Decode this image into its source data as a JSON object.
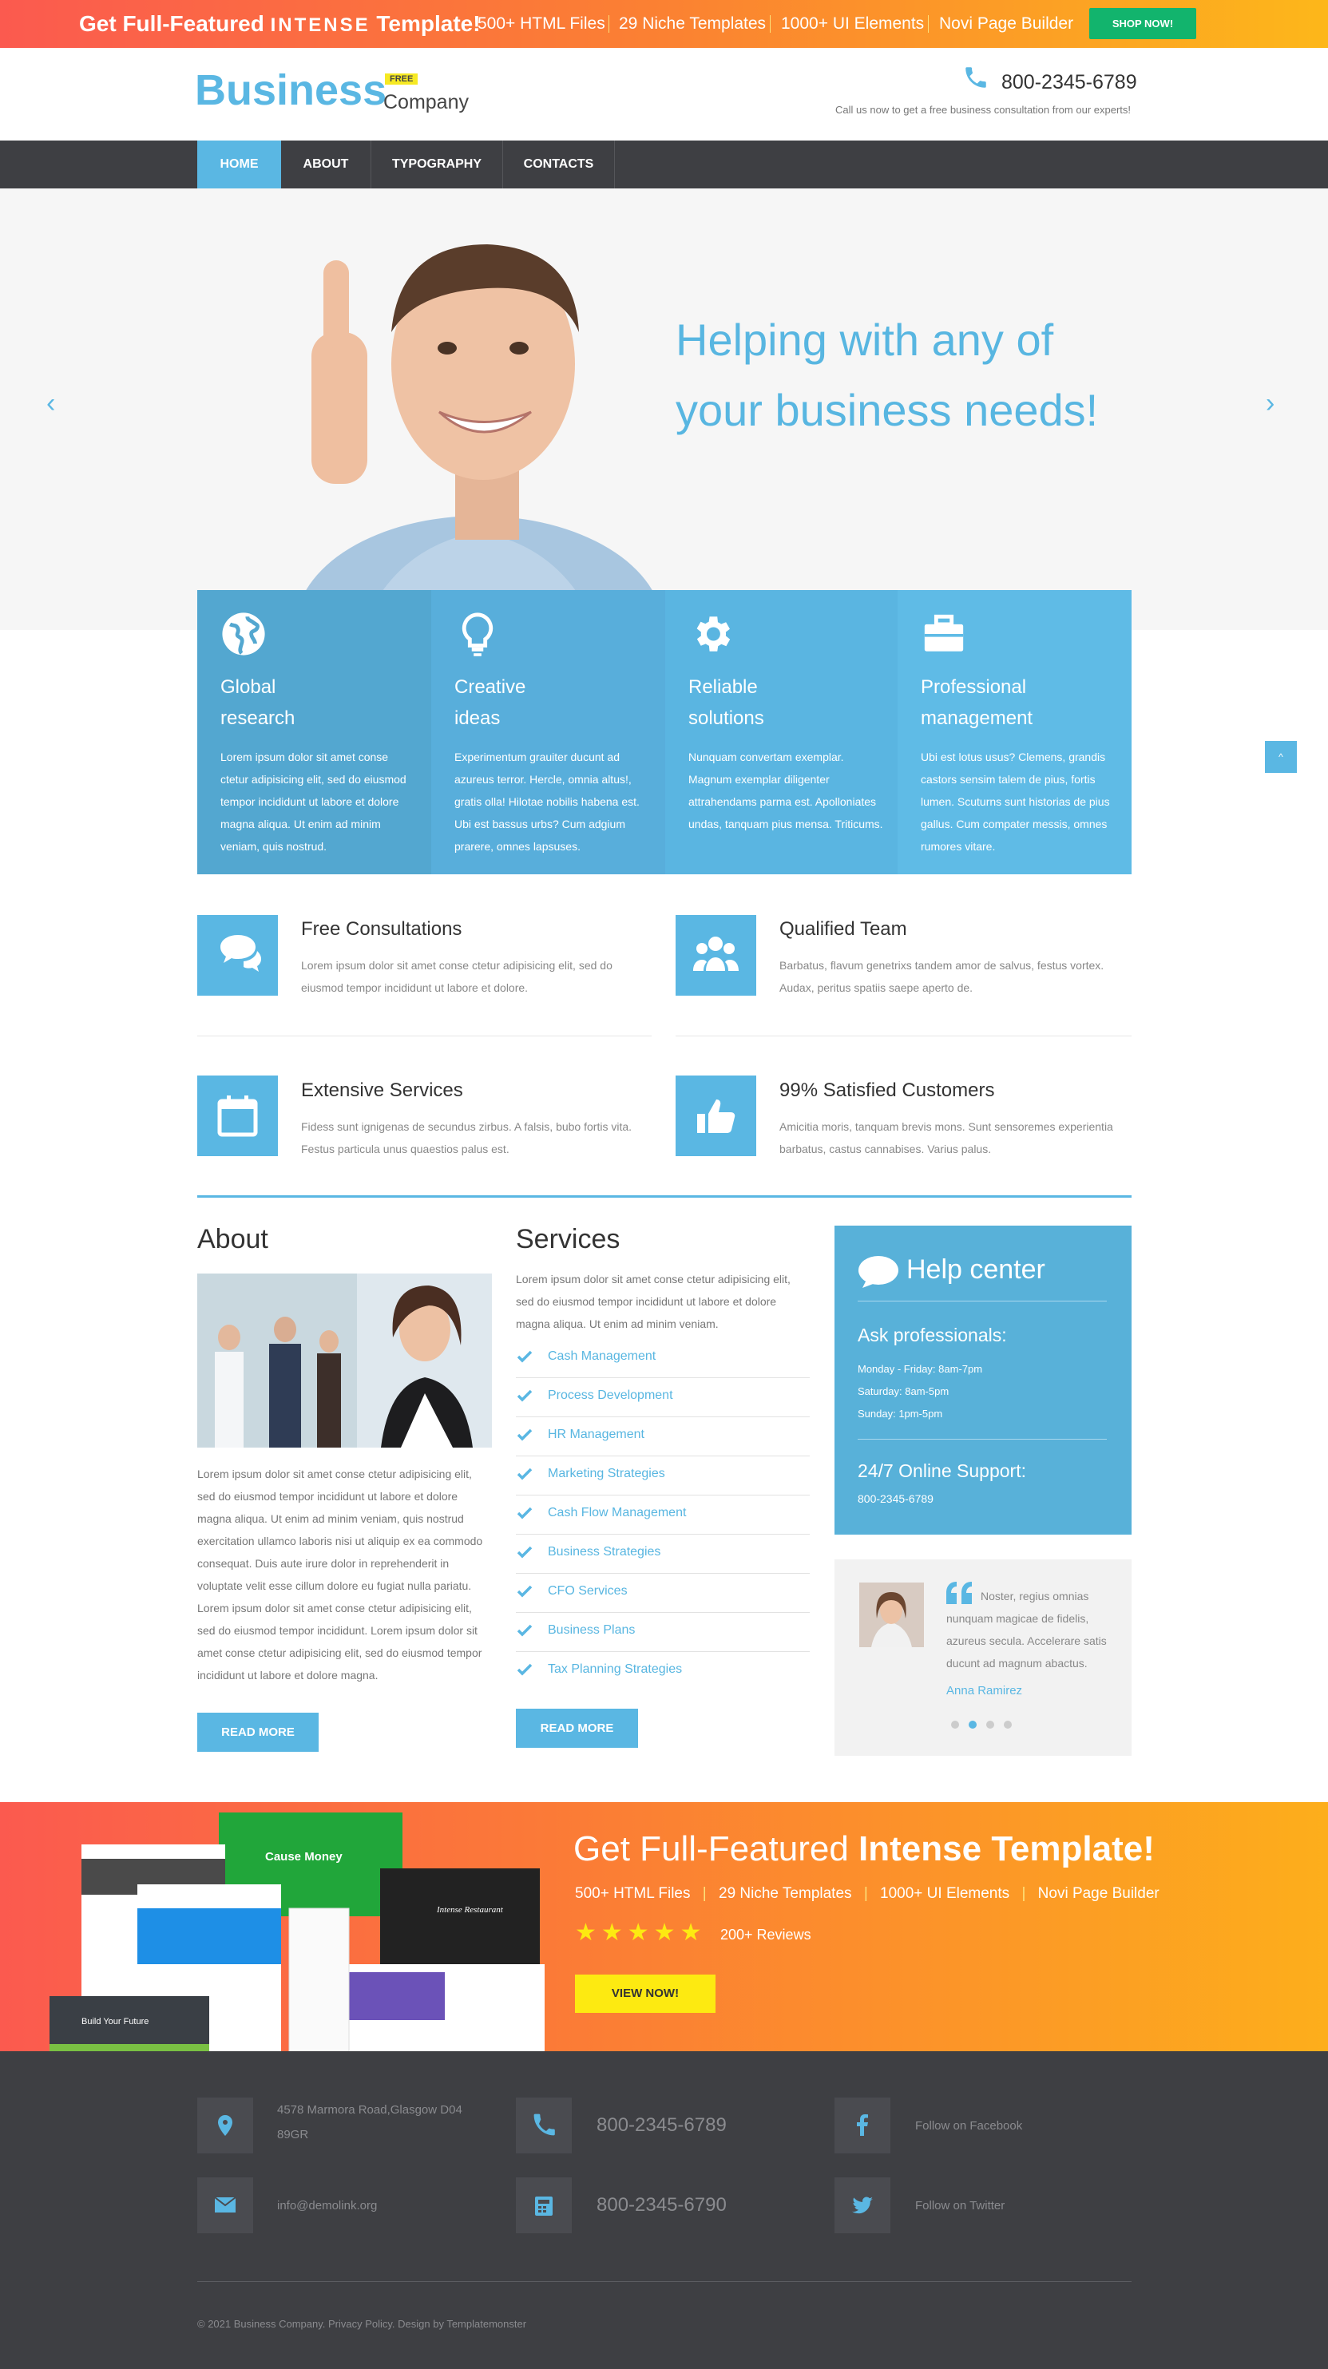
{
  "promo": {
    "title_a": "Get Full-Featured",
    "title_b": "INTENSE",
    "title_c": "Template!",
    "features": [
      "500+ HTML Files",
      "29 Niche Templates",
      "1000+ UI Elements",
      "Novi Page Builder"
    ],
    "button": "SHOP NOW!"
  },
  "header": {
    "logo_main": "Business",
    "logo_badge": "FREE",
    "logo_sub": "Company",
    "phone": "800-2345-6789",
    "call_text": "Call us now to get a free business consultation from our experts!"
  },
  "nav": {
    "items": [
      "HOME",
      "ABOUT",
      "TYPOGRAPHY",
      "CONTACTS"
    ],
    "active": "HOME"
  },
  "hero": {
    "line1": "Helping with any of",
    "line2": "your business needs!",
    "prev": "‹",
    "next": "›"
  },
  "cards": [
    {
      "icon": "globe-icon",
      "t1": "Global",
      "t2": "research",
      "text": "Lorem ipsum dolor sit amet conse ctetur adipisicing elit, sed do eiusmod tempor incididunt ut labore et dolore magna aliqua. Ut enim ad minim veniam, quis nostrud.",
      "color": "#53a7d0"
    },
    {
      "icon": "lightbulb-icon",
      "t1": "Creative",
      "t2": "ideas",
      "text": "Experimentum grauiter ducunt ad azureus terror. Hercle, omnia altus!, gratis olla! Hilotae nobilis habena est. Ubi est bassus urbs? Cum adgium prarere, omnes lapsuses.",
      "color": "#58aedb"
    },
    {
      "icon": "gear-icon",
      "t1": "Reliable",
      "t2": "solutions",
      "text": "Nunquam convertam exemplar. Magnum exemplar diligenter attrahendams parma est. Apolloniates undas, tanquam pius mensa. Triticums.",
      "color": "#5ab5e1"
    },
    {
      "icon": "briefcase-icon",
      "t1": "Professional",
      "t2": "management",
      "text": "Ubi est lotus usus? Clemens, grandis castors sensim talem de pius, fortis lumen. Scuturns sunt historias de pius gallus. Cum compater messis, omnes rumores vitare.",
      "color": "#5fbbe6"
    }
  ],
  "features": [
    {
      "icon": "chat-icon",
      "title": "Free Consultations",
      "text": "Lorem ipsum dolor sit amet conse ctetur adipisicing elit, sed do eiusmod tempor incididunt ut labore et dolore."
    },
    {
      "icon": "team-icon",
      "title": "Qualified Team",
      "text": "Barbatus, flavum genetrixs tandem amor de salvus, festus vortex. Audax, peritus spatiis saepe aperto de."
    },
    {
      "icon": "calendar-icon",
      "title": "Extensive Services",
      "text": "Fidess sunt ignigenas de secundus zirbus. A falsis, bubo fortis vita. Festus particula unus quaestios palus est."
    },
    {
      "icon": "thumbs-up-icon",
      "title": "99% Satisfied Customers",
      "text": "Amicitia moris, tanquam brevis mons. Sunt sensoremes experientia barbatus, castus cannabises. Varius palus."
    }
  ],
  "about": {
    "title": "About",
    "text": "Lorem ipsum dolor sit amet conse ctetur adipisicing elit, sed do eiusmod tempor incididunt ut labore et dolore magna aliqua. Ut enim ad minim veniam, quis nostrud exercitation ullamco laboris nisi ut aliquip ex ea commodo consequat. Duis aute irure dolor in reprehenderit in voluptate velit esse cillum dolore eu fugiat nulla pariatu. Lorem ipsum dolor sit amet conse ctetur adipisicing elit, sed do eiusmod tempor incididunt. Lorem ipsum dolor sit amet conse ctetur adipisicing elit, sed do eiusmod tempor incididunt ut labore et dolore magna.",
    "button": "READ MORE"
  },
  "services": {
    "title": "Services",
    "intro": "Lorem ipsum dolor sit amet conse ctetur adipisicing elit, sed do eiusmod tempor incididunt ut labore et dolore magna aliqua. Ut enim ad minim veniam.",
    "items": [
      "Cash Management",
      "Process Development",
      "HR Management",
      "Marketing Strategies",
      "Cash Flow Management",
      "Business Strategies",
      "CFO Services",
      "Business Plans",
      "Tax Planning Strategies"
    ],
    "button": "READ MORE"
  },
  "help": {
    "title": "Help center",
    "ask": "Ask professionals:",
    "hours": [
      "Monday - Friday: 8am-7pm",
      "Saturday: 8am-5pm",
      "Sunday: 1pm-5pm"
    ],
    "support": "24/7 Online Support:",
    "phone": "800-2345-6789"
  },
  "testimonial": {
    "text": "Noster, regius omnias nunquam magicae de fidelis, azureus secula. Accelerare satis ducunt ad magnum abactus.",
    "name": "Anna Ramirez"
  },
  "banner": {
    "title_a": "Get Full-Featured",
    "title_b": "Intense Template!",
    "features": [
      "500+ HTML Files",
      "29 Niche Templates",
      "1000+ UI Elements",
      "Novi Page Builder"
    ],
    "reviews": "200+ Reviews",
    "button": "VIEW NOW!",
    "mock_texts": [
      "Cause Money",
      "Build Your Future",
      "Intense Restaurant"
    ]
  },
  "footer": {
    "address": "4578 Marmora Road,Glasgow D04 89GR",
    "email": "info@demolink.org",
    "phone1": "800-2345-6789",
    "phone2": "800-2345-6790",
    "facebook": "Follow on Facebook",
    "twitter": "Follow on Twitter",
    "copyright": "©  2021 Business Company. Privacy Policy. Design by Templatemonster"
  },
  "colors": {
    "accent": "#5ab7e3",
    "dark": "#3e3f43",
    "green": "#12b46d"
  }
}
